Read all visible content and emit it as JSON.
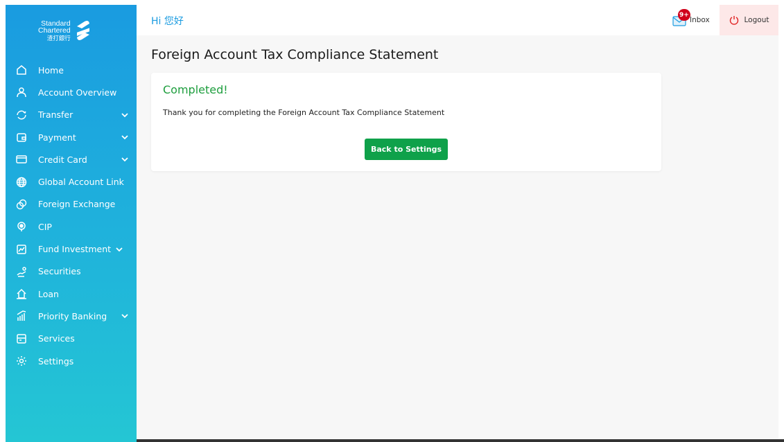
{
  "brand": {
    "line1": "Standard",
    "line2": "Chartered",
    "line3": "渣打銀行"
  },
  "nav": {
    "items": [
      {
        "label": "Home",
        "icon": "home-icon",
        "has_chevron": false
      },
      {
        "label": "Account Overview",
        "icon": "user-icon",
        "has_chevron": false
      },
      {
        "label": "Transfer",
        "icon": "transfer-icon",
        "has_chevron": true
      },
      {
        "label": "Payment",
        "icon": "wallet-icon",
        "has_chevron": true
      },
      {
        "label": "Credit Card",
        "icon": "credit-card-icon",
        "has_chevron": true
      },
      {
        "label": "Global Account Link",
        "icon": "globe-icon",
        "has_chevron": false
      },
      {
        "label": "Foreign Exchange",
        "icon": "exchange-icon",
        "has_chevron": false
      },
      {
        "label": "CIP",
        "icon": "cip-icon",
        "has_chevron": false
      },
      {
        "label": "Fund Investment",
        "icon": "fund-icon",
        "has_chevron": true
      },
      {
        "label": "Securities",
        "icon": "securities-icon",
        "has_chevron": false
      },
      {
        "label": "Loan",
        "icon": "loan-icon",
        "has_chevron": false
      },
      {
        "label": "Priority Banking",
        "icon": "priority-icon",
        "has_chevron": true
      },
      {
        "label": "Services",
        "icon": "services-icon",
        "has_chevron": false
      },
      {
        "label": "Settings",
        "icon": "gear-icon",
        "has_chevron": false
      }
    ]
  },
  "header": {
    "greeting": "Hi 您好",
    "inbox_badge": "9+",
    "inbox_label": "Inbox",
    "logout_label": "Logout"
  },
  "main": {
    "title": "Foreign Account Tax Compliance Statement",
    "card": {
      "heading": "Completed!",
      "message": "Thank you for completing the Foreign Account Tax Compliance Statement",
      "button_label": "Back to Settings"
    }
  },
  "colors": {
    "sidebar_top": "#1a9be0",
    "sidebar_bottom": "#24c6d4",
    "success_green": "#1e9e3e",
    "button_green": "#0fa14a",
    "badge_red": "#d0021b"
  }
}
